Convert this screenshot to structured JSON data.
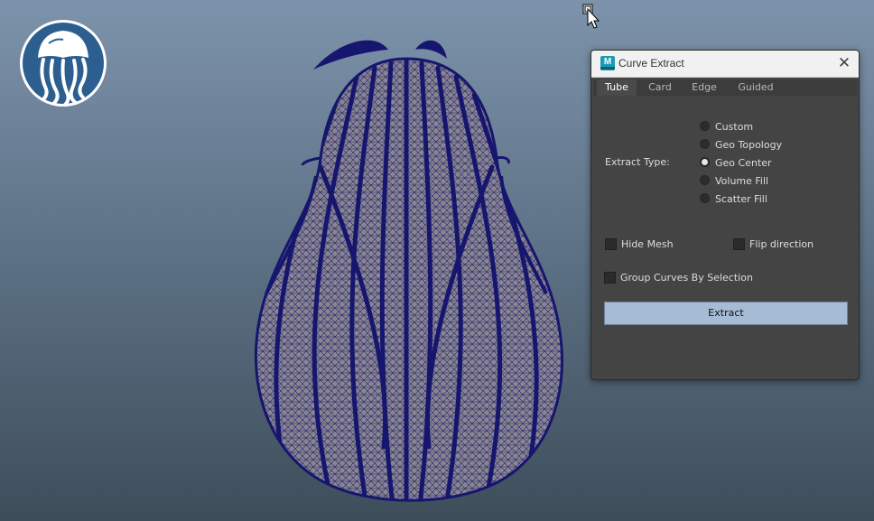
{
  "dialog": {
    "title": "Curve Extract",
    "app_icon_letter": "M",
    "tabs": [
      {
        "label": "Tube",
        "active": true
      },
      {
        "label": "Card",
        "active": false
      },
      {
        "label": "Edge",
        "active": false
      },
      {
        "label": "Guided",
        "active": false
      }
    ],
    "extract_type_label": "Extract Type:",
    "extract_types": [
      {
        "label": "Custom",
        "checked": false
      },
      {
        "label": "Geo Topology",
        "checked": false
      },
      {
        "label": "Geo Center",
        "checked": true
      },
      {
        "label": "Volume Fill",
        "checked": false
      },
      {
        "label": "Scatter Fill",
        "checked": false
      }
    ],
    "hide_mesh_label": "Hide Mesh",
    "flip_direction_label": "Flip direction",
    "group_curves_label": "Group Curves By Selection",
    "extract_button_label": "Extract"
  },
  "colors": {
    "wire": "#16166e",
    "mesh_fill": "#8a8690",
    "button_bg": "#a6bcd4",
    "logo_blue": "#2c5f8f"
  },
  "icons": {
    "logo": "jellyfish-logo-icon",
    "close": "close-icon",
    "cursor": "mouse-pointer-icon"
  }
}
